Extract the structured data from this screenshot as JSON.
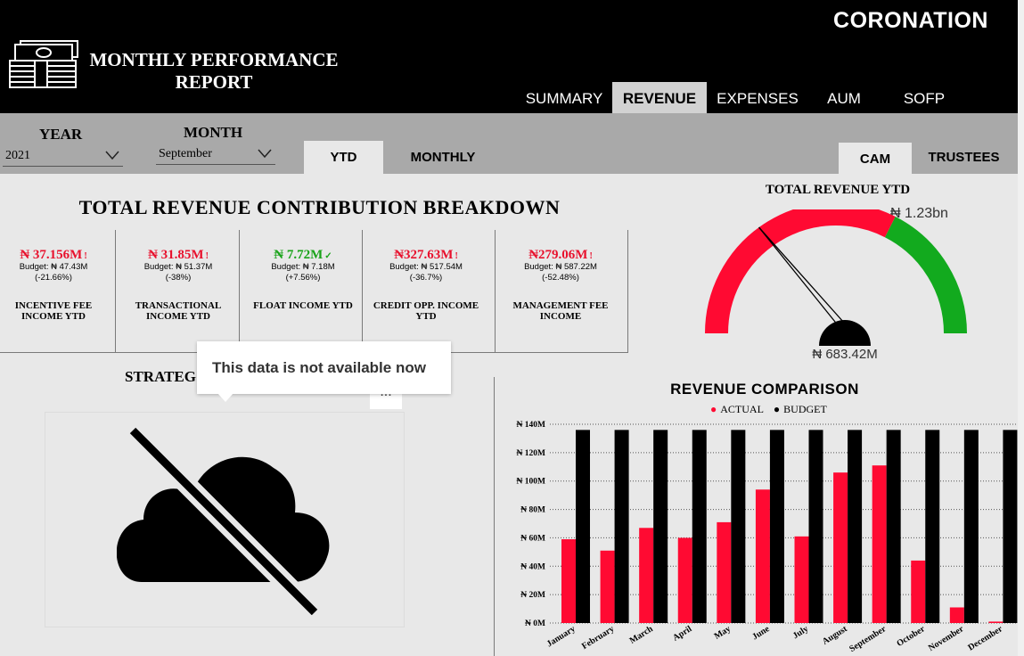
{
  "header": {
    "title_line1": "MONTHLY PERFORMANCE",
    "title_line2": "REPORT",
    "brand": "CORONATION",
    "logo_icon": "money-stack-icon",
    "nav": [
      {
        "label": "SUMMARY",
        "active": false
      },
      {
        "label": "REVENUE",
        "active": true
      },
      {
        "label": "EXPENSES",
        "active": false
      },
      {
        "label": "AUM",
        "active": false
      },
      {
        "label": "SOFP",
        "active": false
      }
    ]
  },
  "filters": {
    "year_label": "YEAR",
    "year_value": "2021",
    "month_label": "MONTH",
    "month_value": "September",
    "period_buttons": [
      {
        "label": "YTD",
        "active": true
      },
      {
        "label": "MONTHLY",
        "active": false
      }
    ],
    "entity_buttons": [
      {
        "label": "CAM",
        "active": true
      },
      {
        "label": "TRUSTEES",
        "active": false
      }
    ]
  },
  "breakdown": {
    "title": "TOTAL REVENUE CONTRIBUTION BREAKDOWN",
    "cards": [
      {
        "value": "₦ 37.156M",
        "flag": "!",
        "budget": "Budget: ₦ 47.43M",
        "pct": "(-21.66%)",
        "label": "INCENTIVE FEE INCOME YTD",
        "color": "#e8112d"
      },
      {
        "value": "₦ 31.85M",
        "flag": "!",
        "budget": "Budget: ₦ 51.37M",
        "pct": "(-38%)",
        "label": "TRANSACTIONAL INCOME YTD",
        "color": "#e8112d"
      },
      {
        "value": "₦ 7.72M",
        "flag": "✓",
        "budget": "Budget: ₦ 7.18M",
        "pct": "(+7.56%)",
        "label": "FLOAT INCOME YTD",
        "color": "#1aa31a"
      },
      {
        "value": "₦327.63M",
        "flag": "!",
        "budget": "Budget: ₦ 517.54M",
        "pct": "(-36.7%)",
        "label": "CREDIT OPP. INCOME YTD",
        "color": "#e8112d"
      },
      {
        "value": "₦279.06M",
        "flag": "!",
        "budget": "Budget: ₦ 587.22M",
        "pct": "(-52.48%)",
        "label": "MANAGEMENT FEE INCOME",
        "color": "#e8112d"
      }
    ]
  },
  "gauge": {
    "title": "TOTAL REVENUE YTD",
    "max_label": "₦ 1.23bn",
    "value_label": "₦ 683.42M",
    "value_fraction": 0.3,
    "red_fraction": 0.65,
    "colors": {
      "red": "#ff0a32",
      "green": "#12aa1e",
      "needle": "#000000"
    }
  },
  "strategic": {
    "title": "STRATEG",
    "tooltip": "This data is not available now",
    "more_label": "...",
    "icon": "cloud-off-icon"
  },
  "chart_data": {
    "type": "bar",
    "title": "REVENUE COMPARISON",
    "legend": [
      "ACTUAL",
      "BUDGET"
    ],
    "legend_position": "top-center",
    "categories": [
      "January",
      "February",
      "March",
      "April",
      "May",
      "June",
      "July",
      "August",
      "September",
      "October",
      "November",
      "December"
    ],
    "series": [
      {
        "name": "ACTUAL",
        "color": "#ff0a32",
        "values": [
          59,
          51,
          67,
          60,
          71,
          94,
          61,
          106,
          111,
          44,
          11,
          1
        ]
      },
      {
        "name": "BUDGET",
        "color": "#000000",
        "values": [
          136,
          136,
          136,
          136,
          136,
          136,
          136,
          136,
          136,
          136,
          136,
          136
        ]
      }
    ],
    "ylim": [
      0,
      140
    ],
    "yticks": [
      "₦ 0M",
      "₦ 20M",
      "₦ 40M",
      "₦ 60M",
      "₦ 80M",
      "₦ 100M",
      "₦ 120M",
      "₦ 140M"
    ],
    "grid": true
  }
}
